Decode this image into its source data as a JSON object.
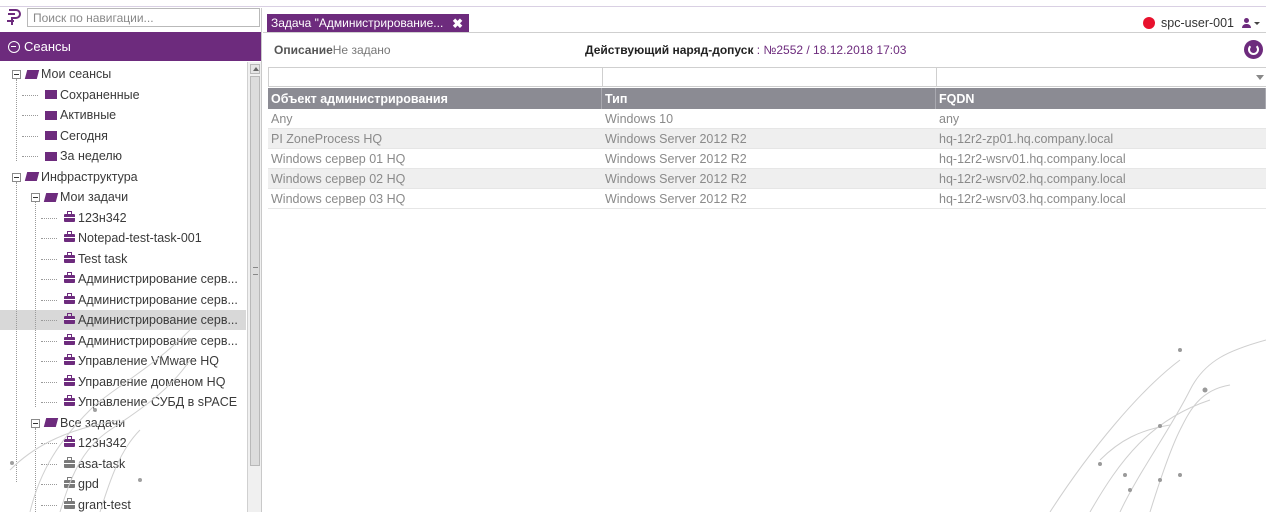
{
  "search": {
    "placeholder": "Поиск по навигации..."
  },
  "sidebar": {
    "header_label": "Сеансы",
    "tree": {
      "my_sessions": "Мои сеансы",
      "saved": "Сохраненные",
      "active": "Активные",
      "today": "Сегодня",
      "week": "За неделю",
      "infrastructure": "Инфраструктура",
      "my_tasks": "Мои задачи",
      "my_task_items": [
        "123н342",
        "Notepad-test-task-001",
        "Test task",
        "Администрирование серв...",
        "Администрирование серв...",
        "Администрирование серв...",
        "Администрирование серв...",
        "Управление VMware HQ",
        "Управление доменом HQ",
        "Управление СУБД в sPACE"
      ],
      "all_tasks": "Все задачи",
      "all_task_items": [
        "123н342",
        "asa-task",
        "gpd",
        "grant-test"
      ]
    }
  },
  "tab": {
    "label": "Задача \"Администрирование...",
    "close": "✖"
  },
  "user": {
    "name": "spc-user-001",
    "status_color": "#e8112d"
  },
  "details": {
    "desc_label": "Описание",
    "desc_value": "Не задано",
    "permit_label": "Действующий наряд-допуск",
    "permit_value": " : №2552 / 18.12.2018 17:03"
  },
  "grid": {
    "headers": [
      "Объект администрирования",
      "Тип",
      "FQDN"
    ],
    "rows": [
      [
        "Any",
        "Windows 10",
        "any"
      ],
      [
        "PI ZoneProcess HQ",
        "Windows Server 2012 R2",
        "hq-12r2-zp01.hq.company.local"
      ],
      [
        "Windows сервер 01 HQ",
        "Windows Server 2012 R2",
        "hq-12r2-wsrv01.hq.company.local"
      ],
      [
        "Windows сервер 02 HQ",
        "Windows Server 2012 R2",
        "hq-12r2-wsrv02.hq.company.local"
      ],
      [
        "Windows сервер 03 HQ",
        "Windows Server 2012 R2",
        "hq-12r2-wsrv03.hq.company.local"
      ]
    ]
  },
  "colors": {
    "accent": "#6d2b7d",
    "grid_header": "#8b8b93",
    "selected_row": "#d8d8d8"
  }
}
